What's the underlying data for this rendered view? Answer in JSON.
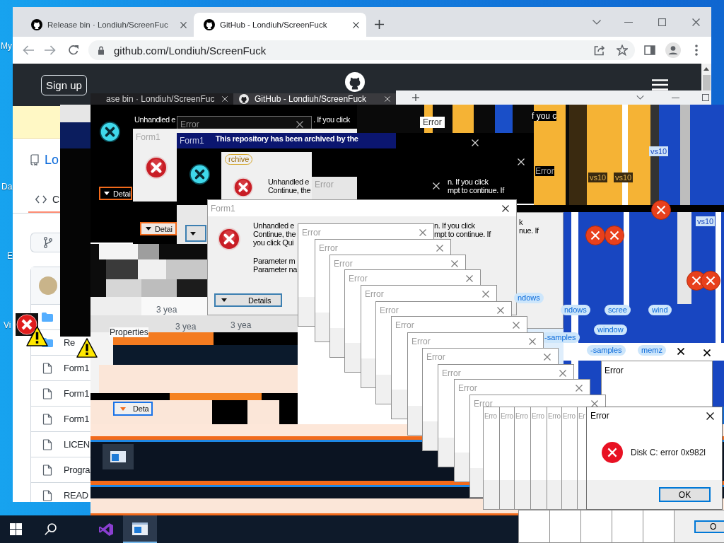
{
  "desktop": {
    "icon_labels": [
      "My",
      "Da",
      "E",
      "Vi"
    ]
  },
  "browser": {
    "tabs": [
      {
        "title": "Release bin · Londiuh/ScreenFuc",
        "selected": false
      },
      {
        "title": "GitHub - Londiuh/ScreenFuck",
        "selected": true
      }
    ],
    "address": "github.com/Londiuh/ScreenFuck"
  },
  "github": {
    "sign_up": "Sign up",
    "repo_name": "Lo",
    "code_tab": "C",
    "files": [
      {
        "kind": "folder"
      },
      {
        "kind": "folder",
        "name": "Re"
      },
      {
        "kind": "file",
        "name": "Form1"
      },
      {
        "kind": "file",
        "name": "Form1"
      },
      {
        "kind": "file",
        "name": "Form1"
      },
      {
        "kind": "file",
        "name": "LICEN"
      },
      {
        "kind": "file",
        "name": "Progra"
      },
      {
        "kind": "file",
        "name": "READ"
      }
    ]
  },
  "glitch": {
    "tabs": [
      {
        "title": "ase bin · Londiuh/ScreenFuc",
        "selected": false
      },
      {
        "title": "GitHub - Londiuh/ScreenFuck",
        "selected": true
      }
    ],
    "fragments": [
      "Properties",
      "3 yea",
      "3 yea",
      "3 yea",
      "Error",
      "Error",
      "f you c",
      "vs10",
      "vs10",
      "vs10",
      "vs10"
    ],
    "buttons": [
      "Deta"
    ],
    "topics": [
      "ndows",
      "ndows",
      "scree",
      "wind",
      "window",
      "-samples",
      "-samples",
      "memz"
    ]
  },
  "form_dialogs": [
    {
      "kind": "inverted",
      "message": [
        "Unhandled e"
      ],
      "message_right": [
        ". If you click"
      ],
      "button": "Detai"
    },
    {
      "kind": "split",
      "title": "Form1",
      "button": "Detai"
    },
    {
      "kind": "navy",
      "title": "Form1",
      "banner": "This repository has been archived by the"
    },
    {
      "kind": "plain",
      "badge": "rchive",
      "message": [
        "Unhandled e",
        "Continue, the"
      ]
    },
    {
      "kind": "inverted",
      "message_right": [
        "n. If you click",
        "mpt to continue. If"
      ]
    },
    {
      "kind": "plain",
      "title": "Form1",
      "message": [
        "Unhandled e",
        "Continue, the",
        "you click Qui"
      ],
      "details": [
        "Parameter m",
        "Parameter na"
      ],
      "message_right": [
        "n. If you click",
        "mpt to continue. If"
      ],
      "button": "Details"
    },
    {
      "kind": "plain",
      "message": [
        "k",
        "nue. If"
      ]
    }
  ],
  "small_errors": [
    {
      "kind": "dark",
      "title": "Error"
    },
    {
      "kind": "light",
      "title": "Error"
    }
  ],
  "error_windows": [
    {
      "title": "Error"
    },
    {
      "title": "Error"
    },
    {
      "title": "Error"
    },
    {
      "title": "Error"
    },
    {
      "title": "Error"
    },
    {
      "title": "Error"
    },
    {
      "title": "Error"
    },
    {
      "title": "Error"
    },
    {
      "title": "Error"
    },
    {
      "title": "Error"
    },
    {
      "title": "Error"
    },
    {
      "title": "Error"
    }
  ],
  "error_strips": [
    {
      "title": "Erro"
    },
    {
      "title": "Erro"
    },
    {
      "title": "Erro"
    },
    {
      "title": "Erro"
    },
    {
      "title": "Erro"
    },
    {
      "title": "Erro"
    },
    {
      "title": "Er"
    }
  ],
  "side_error": {
    "title": "Error"
  },
  "final_error": {
    "title": "Error",
    "message": "Disk C: error 0x982l",
    "button": "OK"
  },
  "partial_button": "O",
  "alert_icons": [
    {
      "kind": "square-error"
    },
    {
      "kind": "warning"
    },
    {
      "kind": "warning"
    },
    {
      "kind": "error"
    },
    {
      "kind": "error"
    },
    {
      "kind": "error"
    },
    {
      "kind": "error"
    },
    {
      "kind": "error"
    }
  ],
  "taskbar": {
    "apps": [
      {
        "kind": "ide",
        "selected": false
      },
      {
        "kind": "form-app",
        "selected": true
      }
    ]
  }
}
